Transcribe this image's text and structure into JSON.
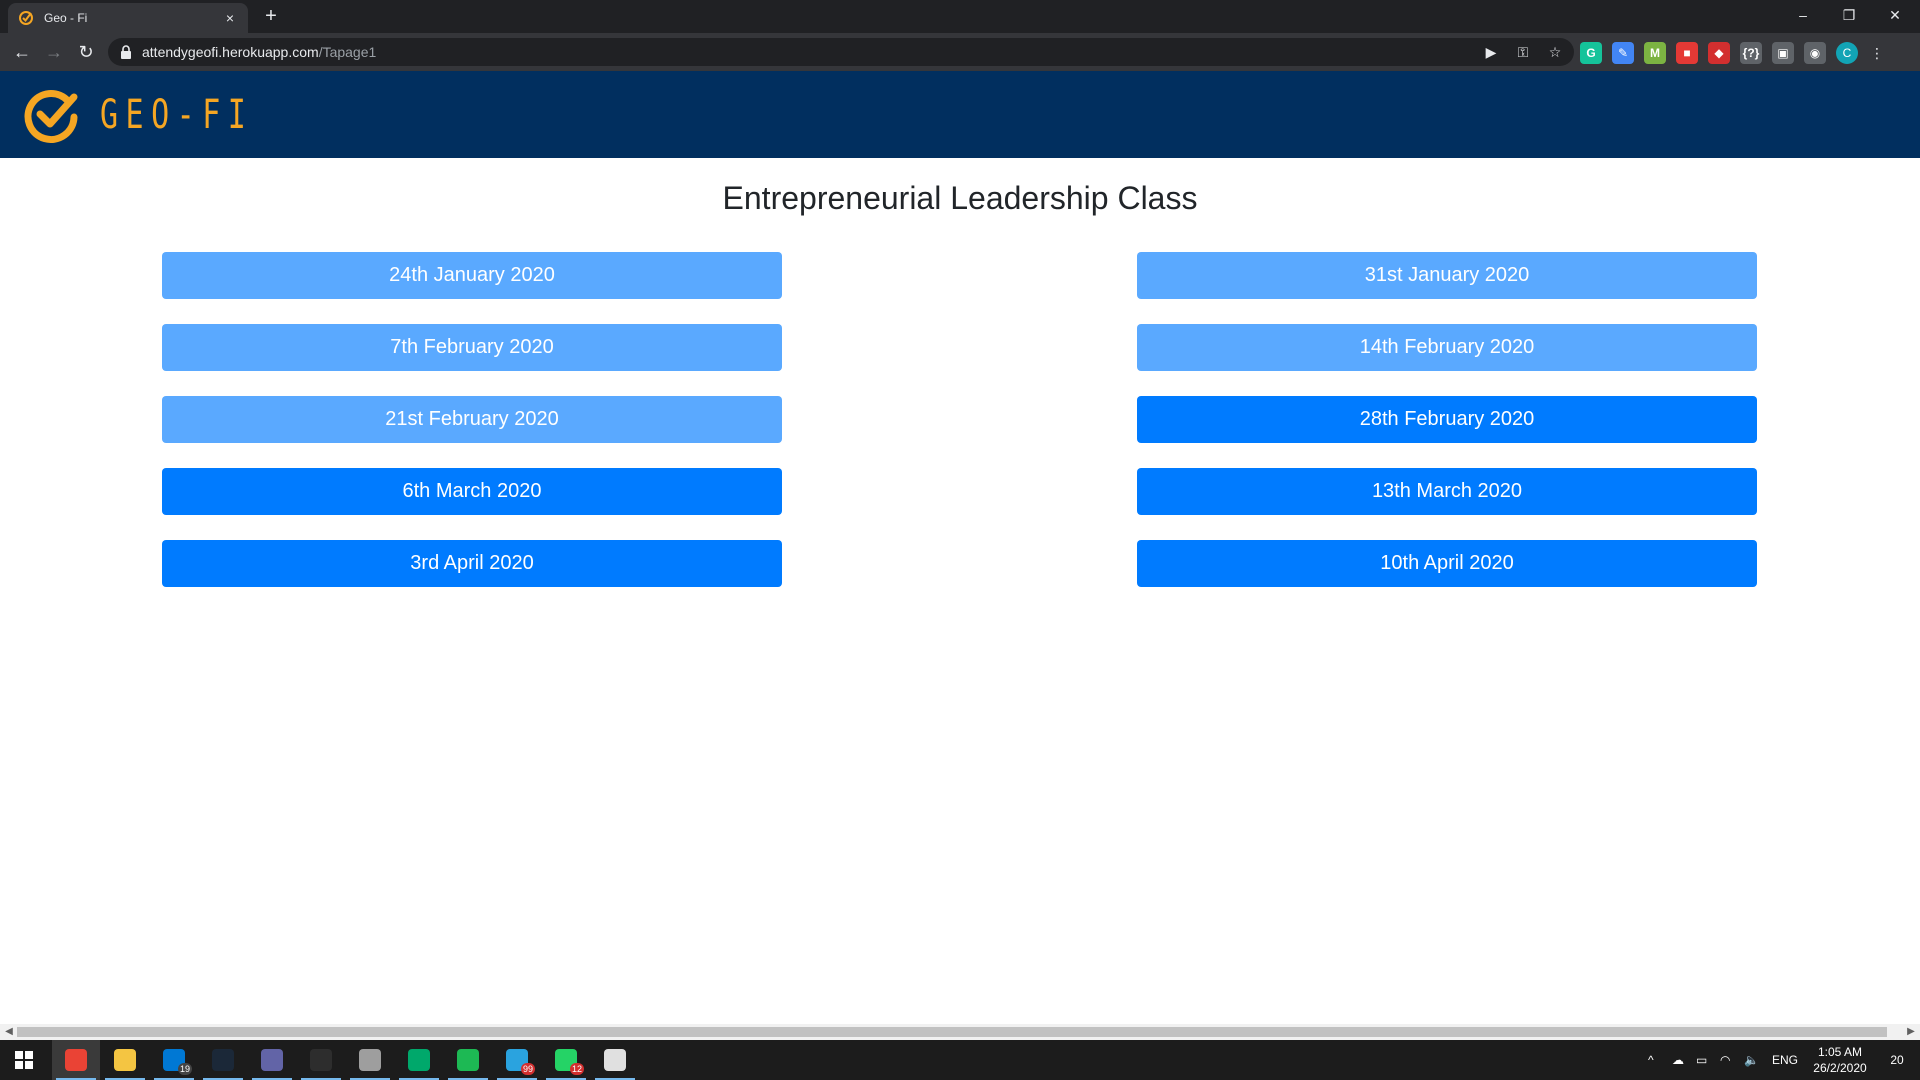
{
  "browser": {
    "tab_title": "Geo - Fi",
    "tab_close": "×",
    "new_tab": "+",
    "url_host": "attendygeofi.herokuapp.com",
    "url_path": "/Tapage1",
    "window_controls": {
      "minimize": "–",
      "restore": "❐",
      "close": "✕"
    },
    "nav": {
      "back": "←",
      "forward": "→",
      "reload": "↻"
    },
    "omnibox_icons": {
      "camera": "▶",
      "key": "⚿",
      "star": "☆"
    },
    "extensions": [
      {
        "name": "grammarly",
        "label": "G",
        "color": "#15c39a"
      },
      {
        "name": "pen",
        "label": "✎",
        "color": "#4285f4"
      },
      {
        "name": "m-extension",
        "label": "M",
        "color": "#7cb342"
      },
      {
        "name": "colorful",
        "label": "■",
        "color": "#e53935"
      },
      {
        "name": "red-extension",
        "label": "◆",
        "color": "#d32f2f"
      },
      {
        "name": "brackets",
        "label": "{?}",
        "color": "#5f6368"
      },
      {
        "name": "gray-extension",
        "label": "▣",
        "color": "#5f6368"
      },
      {
        "name": "camera-extension",
        "label": "◉",
        "color": "#5f6368"
      }
    ],
    "profile_initial": "C",
    "menu": "⋮"
  },
  "header": {
    "logo_text": "GEO-FI",
    "brand_color": "#f5a623",
    "bg_color": "#012f5f"
  },
  "page": {
    "title": "Entrepreneurial Leadership Class",
    "dates_left": [
      {
        "label": "24th January 2020",
        "state": "light"
      },
      {
        "label": "7th February 2020",
        "state": "light"
      },
      {
        "label": "21st February 2020",
        "state": "light"
      },
      {
        "label": "6th March 2020",
        "state": "dark"
      },
      {
        "label": "3rd April 2020",
        "state": "dark"
      }
    ],
    "dates_right": [
      {
        "label": "31st January 2020",
        "state": "light"
      },
      {
        "label": "14th February 2020",
        "state": "light"
      },
      {
        "label": "28th February 2020",
        "state": "dark"
      },
      {
        "label": "13th March 2020",
        "state": "dark"
      },
      {
        "label": "10th April 2020",
        "state": "dark"
      }
    ],
    "colors": {
      "light": "#5aa9ff",
      "dark": "#007bff"
    }
  },
  "taskbar": {
    "apps": [
      {
        "name": "chrome",
        "color": "#ea4335",
        "active": true,
        "badge": ""
      },
      {
        "name": "file-explorer",
        "color": "#f4c542",
        "active": false,
        "badge": ""
      },
      {
        "name": "mail",
        "color": "#0078d4",
        "active": false,
        "badge": "19"
      },
      {
        "name": "steam",
        "color": "#1b2838",
        "active": false,
        "badge": ""
      },
      {
        "name": "teams",
        "color": "#6264a7",
        "active": false,
        "badge": ""
      },
      {
        "name": "terminal",
        "color": "#2d2d2d",
        "active": false,
        "badge": ""
      },
      {
        "name": "settings",
        "color": "#9e9e9e",
        "active": false,
        "badge": ""
      },
      {
        "name": "circle-app",
        "color": "#00a86b",
        "active": false,
        "badge": ""
      },
      {
        "name": "spotify-like",
        "color": "#1db954",
        "active": false,
        "badge": ""
      },
      {
        "name": "telegram",
        "color": "#2aa3df",
        "active": false,
        "badge": "99"
      },
      {
        "name": "whatsapp",
        "color": "#25d366",
        "active": false,
        "badge": "12"
      },
      {
        "name": "paint",
        "color": "#e0e0e0",
        "active": false,
        "badge": ""
      }
    ],
    "tray": {
      "chevron": "^",
      "language": "ENG",
      "time": "1:05 AM",
      "date": "26/2/2020",
      "notifications": "20"
    }
  }
}
